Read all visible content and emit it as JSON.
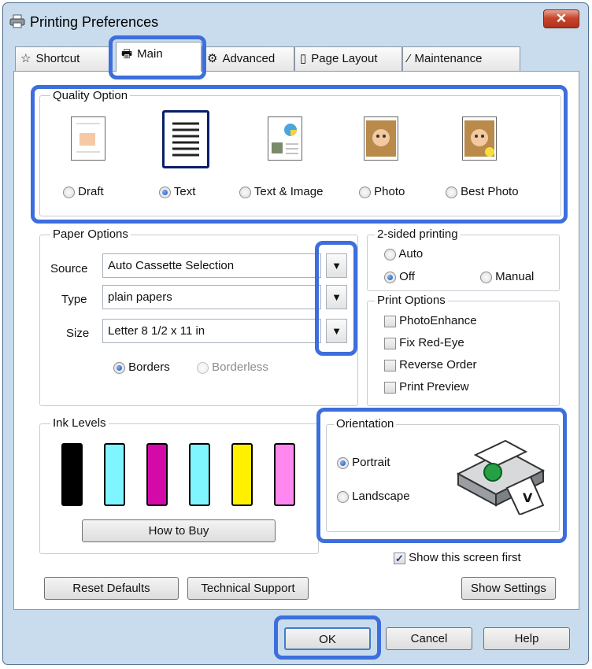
{
  "window": {
    "title": "Printing Preferences",
    "close_label": "✕"
  },
  "tabs": [
    {
      "label": "Shortcut",
      "icon": "star-icon"
    },
    {
      "label": "Main",
      "icon": "printer-icon"
    },
    {
      "label": "Advanced",
      "icon": "gear-icon"
    },
    {
      "label": "Page Layout",
      "icon": "page-icon"
    },
    {
      "label": "Maintenance",
      "icon": "wrench-icon"
    }
  ],
  "quality": {
    "legend": "Quality Option",
    "options": [
      "Draft",
      "Text",
      "Text & Image",
      "Photo",
      "Best Photo"
    ],
    "selected": "Text"
  },
  "paper": {
    "legend": "Paper Options",
    "source_label": "Source",
    "source_value": "Auto Cassette Selection",
    "type_label": "Type",
    "type_value": "plain papers",
    "size_label": "Size",
    "size_value": "Letter 8 1/2 x 11 in",
    "borders": "Borders",
    "borderless": "Borderless"
  },
  "two_sided": {
    "legend": "2-sided printing",
    "auto": "Auto",
    "off": "Off",
    "manual": "Manual",
    "selected": "Off"
  },
  "print_options": {
    "legend": "Print Options",
    "items": [
      "PhotoEnhance",
      "Fix Red-Eye",
      "Reverse Order",
      "Print Preview"
    ]
  },
  "ink": {
    "legend": "Ink Levels",
    "colors": [
      "#000000",
      "#7ff5ff",
      "#d40aa8",
      "#7ff5ff",
      "#fff000",
      "#ff88f0"
    ],
    "how_to_buy": "How to Buy"
  },
  "orientation": {
    "legend": "Orientation",
    "portrait": "Portrait",
    "landscape": "Landscape",
    "selected": "Portrait"
  },
  "show_first": {
    "label": "Show this screen first",
    "checked": true
  },
  "buttons": {
    "reset": "Reset Defaults",
    "support": "Technical Support",
    "show_settings": "Show Settings",
    "ok": "OK",
    "cancel": "Cancel",
    "help": "Help"
  },
  "highlight_color": "#3d6fdc"
}
